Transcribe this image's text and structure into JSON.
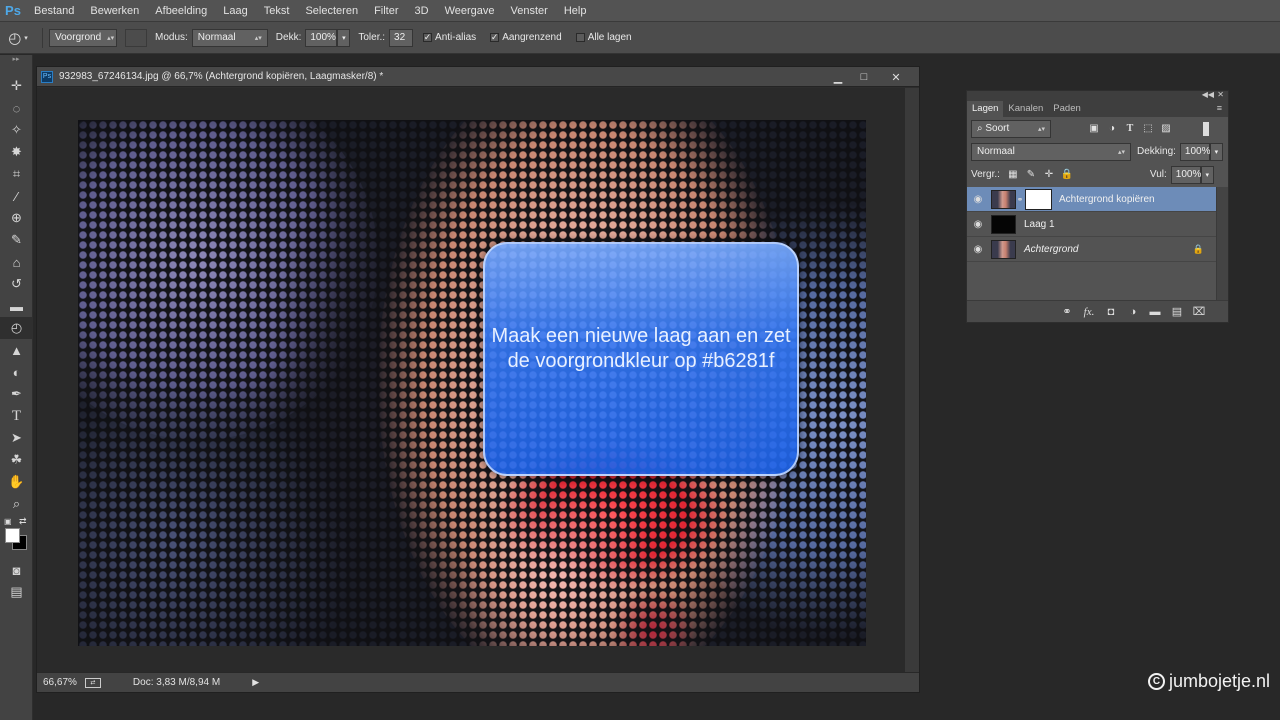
{
  "app": {
    "logo": "Ps"
  },
  "menu": [
    "Bestand",
    "Bewerken",
    "Afbeelding",
    "Laag",
    "Tekst",
    "Selecteren",
    "Filter",
    "3D",
    "Weergave",
    "Venster",
    "Help"
  ],
  "options": {
    "fill_source": "Voorgrond",
    "mode_label": "Modus:",
    "mode_value": "Normaal",
    "opacity_label": "Dekk:",
    "opacity_value": "100%",
    "tolerance_label": "Toler.:",
    "tolerance_value": "32",
    "antialias_label": "Anti-alias",
    "contiguous_label": "Aangrenzend",
    "all_layers_label": "Alle lagen"
  },
  "document": {
    "title": "932983_67246134.jpg @ 66,7% (Achtergrond kopiëren, Laagmasker/8) *",
    "zoom": "66,67%",
    "doc_size": "Doc: 3,83 M/8,94 M"
  },
  "tutorial": {
    "text": "Maak een nieuwe laag aan en zet de voorgrondkleur op #b6281f"
  },
  "layers_panel": {
    "tabs": [
      "Lagen",
      "Kanalen",
      "Paden"
    ],
    "filter_kind": "Soort",
    "blend_mode": "Normaal",
    "opacity_label": "Dekking:",
    "opacity_value": "100%",
    "lock_label": "Vergr.:",
    "fill_label": "Vul:",
    "fill_value": "100%",
    "layers": [
      {
        "name": "Achtergrond kopiëren",
        "selected": true
      },
      {
        "name": "Laag 1",
        "selected": false
      },
      {
        "name": "Achtergrond",
        "selected": false,
        "locked": true
      }
    ]
  },
  "watermark": "jumbojetje.nl",
  "colors": {
    "selected_layer": "#6d8cb8",
    "tip_blue": "#2f78f0",
    "foreground_swatch": "#ffffff",
    "background_swatch": "#000000"
  }
}
